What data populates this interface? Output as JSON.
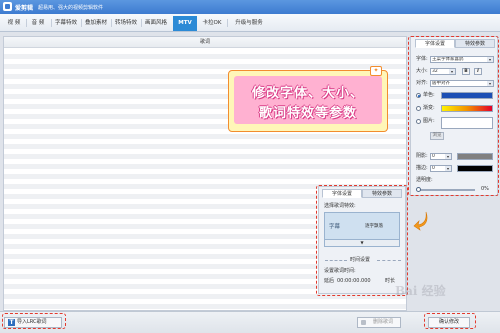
{
  "app": {
    "name": "爱剪辑",
    "slogan": "超易用、强大的视频剪辑软件"
  },
  "menu": [
    "视 频",
    "音 频",
    "字幕特效",
    "叠加素材",
    "转场特效",
    "画面风格",
    "MTV",
    "卡拉OK",
    "升级与服务"
  ],
  "lyrics_panel": {
    "header": "歌词"
  },
  "callout": {
    "line1": "修改字体、大小、",
    "line2": "歌词特效等参数",
    "tag": "✦"
  },
  "settings": {
    "tabs": [
      "字体设置",
      "特效参数"
    ],
    "font_label": "字体:",
    "font_value": "王菜字体家喜鹊",
    "size_label": "大小:",
    "size_value": "32",
    "bold": "B",
    "italic": "I",
    "align_label": "对齐:",
    "align_value": "居中对齐",
    "mono_label": "单色:",
    "gradient_label": "渐变:",
    "image_label": "图片:",
    "browse_label": "浏览",
    "shadow_label": "阴影:",
    "shadow_value": "0",
    "stroke_label": "描边:",
    "stroke_value": "0",
    "opacity_label": "透明度:",
    "opacity_value": "0%",
    "colors": {
      "mono": "#1c4fb4",
      "shadow": "#808080",
      "stroke": "#000000"
    }
  },
  "effects": {
    "tabs": [
      "字体设置",
      "特效参数"
    ],
    "choose_label": "选择歌词特效:",
    "preview_left": "字幕",
    "preview_right": "逐字飘落",
    "scroll_arrow": "▼",
    "timing_header": "时间设置",
    "start_label": "设置歌词时间:",
    "delay_label": "延后",
    "delay_value": "00:00:00.000",
    "duration_label": "时长"
  },
  "bottom": {
    "import": "导入LRC歌词",
    "import_icon": "T",
    "clear": "删除歌词",
    "confirm": "确认修改"
  },
  "watermark": "Bai 经验"
}
